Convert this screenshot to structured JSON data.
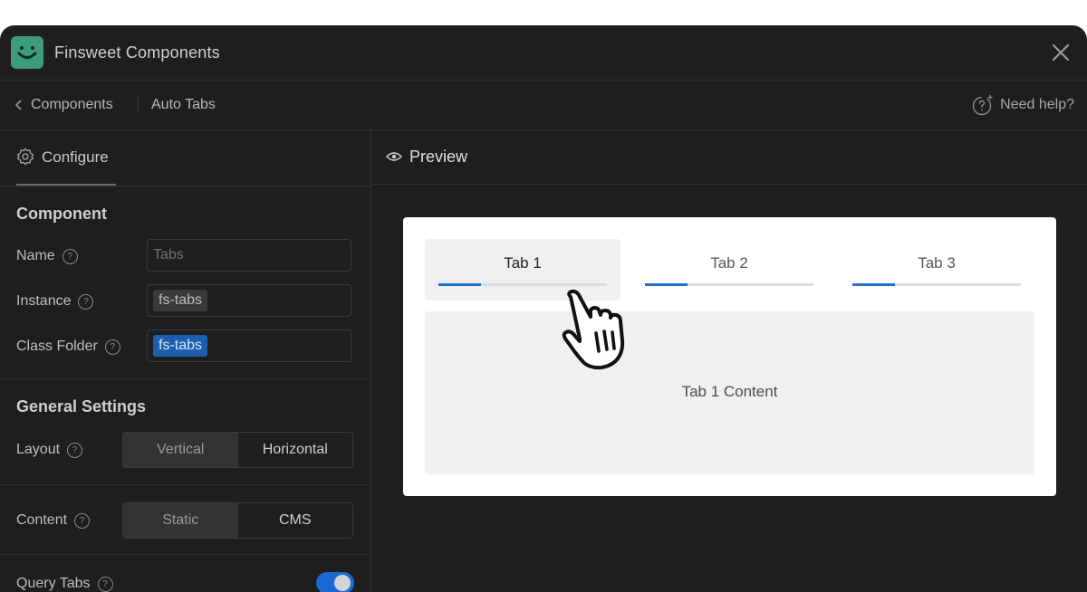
{
  "app": {
    "title": "Finsweet Components",
    "accent": "#3d9c7a"
  },
  "nav": {
    "back_label": "Components",
    "current": "Auto Tabs",
    "help_label": "Need help?"
  },
  "left": {
    "tab_label": "Configure",
    "component": {
      "title": "Component",
      "name_label": "Name",
      "name_placeholder": "Tabs",
      "instance_label": "Instance",
      "instance_value": "fs-tabs",
      "class_folder_label": "Class Folder",
      "class_folder_value": "fs-tabs"
    },
    "general": {
      "title": "General Settings",
      "layout_label": "Layout",
      "layout_options": [
        "Vertical",
        "Horizontal"
      ],
      "layout_selected": "Vertical",
      "content_label": "Content",
      "content_options": [
        "Static",
        "CMS"
      ],
      "content_selected": "Static",
      "query_tabs_label": "Query Tabs",
      "query_tabs_on": true
    }
  },
  "preview": {
    "title": "Preview",
    "tabs": [
      {
        "label": "Tab 1",
        "progress": 0.25,
        "active": true
      },
      {
        "label": "Tab 2",
        "progress": 0.25,
        "active": false
      },
      {
        "label": "Tab 3",
        "progress": 0.25,
        "active": false
      }
    ],
    "content": "Tab 1 Content",
    "progress_color": "#1f6fd0"
  },
  "icons": [
    "logo-icon",
    "close-icon",
    "chevron-left-icon",
    "help-icon",
    "gear-icon",
    "question-icon",
    "eye-icon",
    "hand-cursor-icon"
  ]
}
